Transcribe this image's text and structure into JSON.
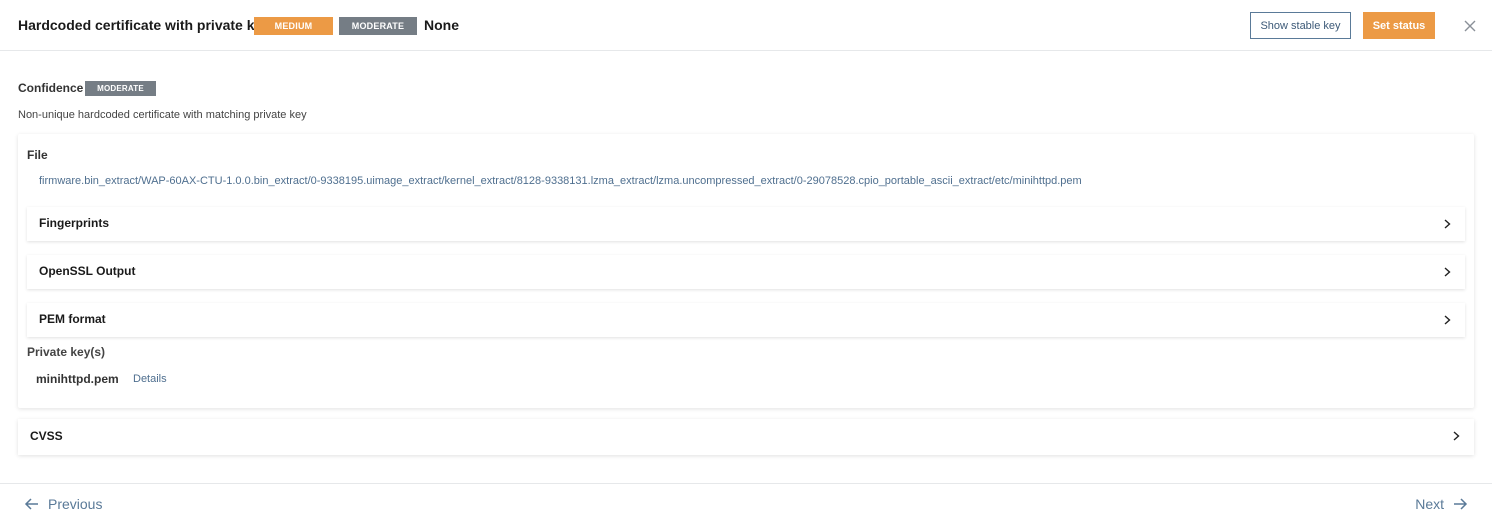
{
  "header": {
    "title": "Hardcoded certificate with private key",
    "severity_badge": "MEDIUM",
    "confidence_badge": "MODERATE",
    "status": "None",
    "show_stable_key_label": "Show stable key",
    "set_status_label": "Set status",
    "close_icon": "close-icon"
  },
  "confidence": {
    "label": "Confidence",
    "badge": "MODERATE"
  },
  "description": "Non-unique hardcoded certificate with matching private key",
  "file": {
    "label": "File",
    "path": "firmware.bin_extract/WAP-60AX-CTU-1.0.0.bin_extract/0-9338195.uimage_extract/kernel_extract/8128-9338131.lzma_extract/lzma.uncompressed_extract/0-29078528.cpio_portable_ascii_extract/etc/minihttpd.pem"
  },
  "sections": [
    {
      "label": "Fingerprints",
      "icon": "chevron-right-icon"
    },
    {
      "label": "OpenSSL Output",
      "icon": "chevron-right-icon"
    },
    {
      "label": "PEM format",
      "icon": "chevron-right-icon"
    }
  ],
  "private_keys": {
    "label": "Private key(s)",
    "items": [
      {
        "name": "minihttpd.pem",
        "details_label": "Details"
      }
    ]
  },
  "cvss": {
    "label": "CVSS",
    "icon": "chevron-right-icon"
  },
  "footer": {
    "previous_label": "Previous",
    "next_label": "Next"
  },
  "colors": {
    "medium": "#ec9a45",
    "moderate": "#757d85",
    "link": "#4f6f8f",
    "primary_button": "#ec9a45"
  }
}
